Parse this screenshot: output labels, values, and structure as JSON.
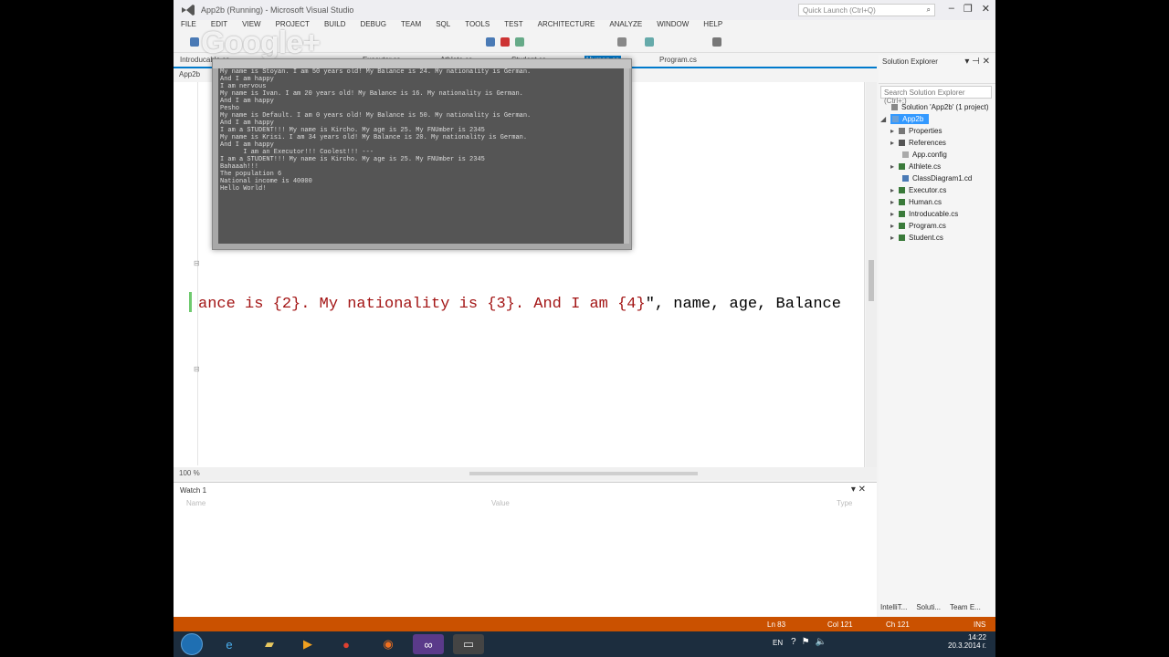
{
  "title_bar": {
    "title": "App2b (Running) - Microsoft Visual Studio",
    "quick_launch_placeholder": "Quick Launch (Ctrl+Q)"
  },
  "menu": [
    "FILE",
    "EDIT",
    "VIEW",
    "PROJECT",
    "BUILD",
    "DEBUG",
    "TEAM",
    "SQL",
    "TOOLS",
    "TEST",
    "ARCHITECTURE",
    "ANALYZE",
    "WINDOW",
    "HELP"
  ],
  "overlay": {
    "brand": "Google+"
  },
  "tabs": {
    "introducable": "Introducable.cs",
    "executor": "Executor.cs",
    "athlete": "Athlete.cs",
    "student": "Student.cs",
    "human": "Human.cs",
    "program": "Program.cs"
  },
  "nav": {
    "project": "App2b"
  },
  "editor": {
    "code_string": "ance is {2}. My nationality is {3}. And I am {4}",
    "code_rest": "\", name, age, Balance"
  },
  "zoom": "100 %",
  "watch": {
    "title": "Watch 1",
    "col_name": "Name",
    "col_value": "Value",
    "col_type": "Type"
  },
  "console_lines": [
    "My name is Stoyan. I am 50 years old! My Balance is 24. My nationality is German.",
    "And I am happy",
    "I am nervous",
    "My name is Ivan. I am 20 years old! My Balance is 16. My nationality is German.",
    "And I am happy",
    "Pesho",
    "My name is Default. I am 0 years old! My Balance is 50. My nationality is German.",
    "And I am happy",
    "I am a STUDENT!!! My name is Kircho. My age is 25. My FNUmber is 2345",
    "My name is Krisi. I am 34 years old! My Balance is 20. My nationality is German.",
    "And I am happy",
    "      I am an Executor!!! Coolest!!! ---",
    "I am a STUDENT!!! My name is Kircho. My age is 25. My FNUmber is 2345",
    "Bahaaah!!!",
    "The population 6",
    "National income is 40000",
    "Hello World!"
  ],
  "solution_explorer": {
    "title": "Solution Explorer",
    "search_placeholder": "Search Solution Explorer (Ctrl+;)",
    "solution": "Solution 'App2b' (1 project)",
    "project": "App2b",
    "items": [
      "Properties",
      "References",
      "App.config",
      "Athlete.cs",
      "ClassDiagram1.cd",
      "Executor.cs",
      "Human.cs",
      "Introducable.cs",
      "Program.cs",
      "Student.cs"
    ],
    "bottom_tabs": [
      "IntelliT...",
      "Soluti...",
      "Team E..."
    ]
  },
  "status": {
    "ln": "Ln 83",
    "col": "Col 121",
    "ch": "Ch 121",
    "mode": "INS"
  },
  "tray": {
    "lang": "EN",
    "time": "14:22",
    "date": "20.3.2014 г."
  },
  "colors": {
    "accent": "#007acc",
    "status_bar": "#ca5100",
    "selected": "#3399ff",
    "string": "#a31515"
  }
}
